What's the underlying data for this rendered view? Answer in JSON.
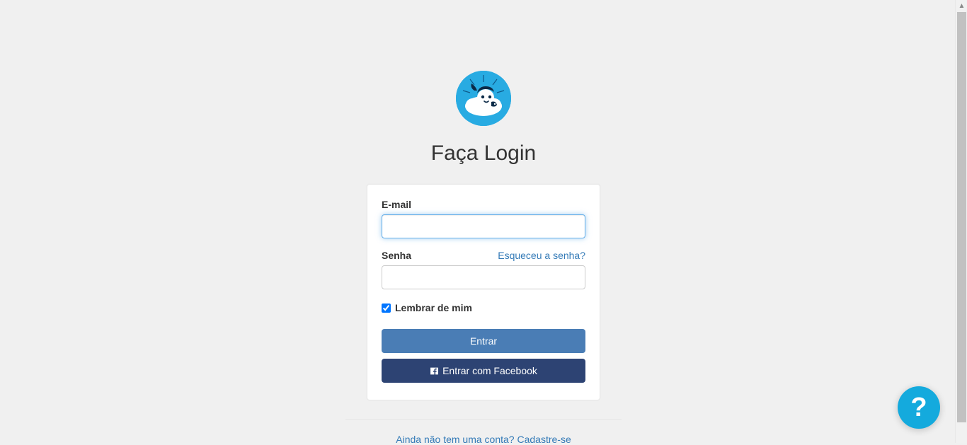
{
  "heading": "Faça Login",
  "form": {
    "email_label": "E-mail",
    "password_label": "Senha",
    "forgot_password": "Esqueceu a senha?",
    "remember_label": "Lembrar de mim",
    "remember_checked": true,
    "submit_label": "Entrar",
    "facebook_label": "Entrar com Facebook"
  },
  "signup_link": "Ainda não tem uma conta? Cadastre-se",
  "help_button": "?"
}
